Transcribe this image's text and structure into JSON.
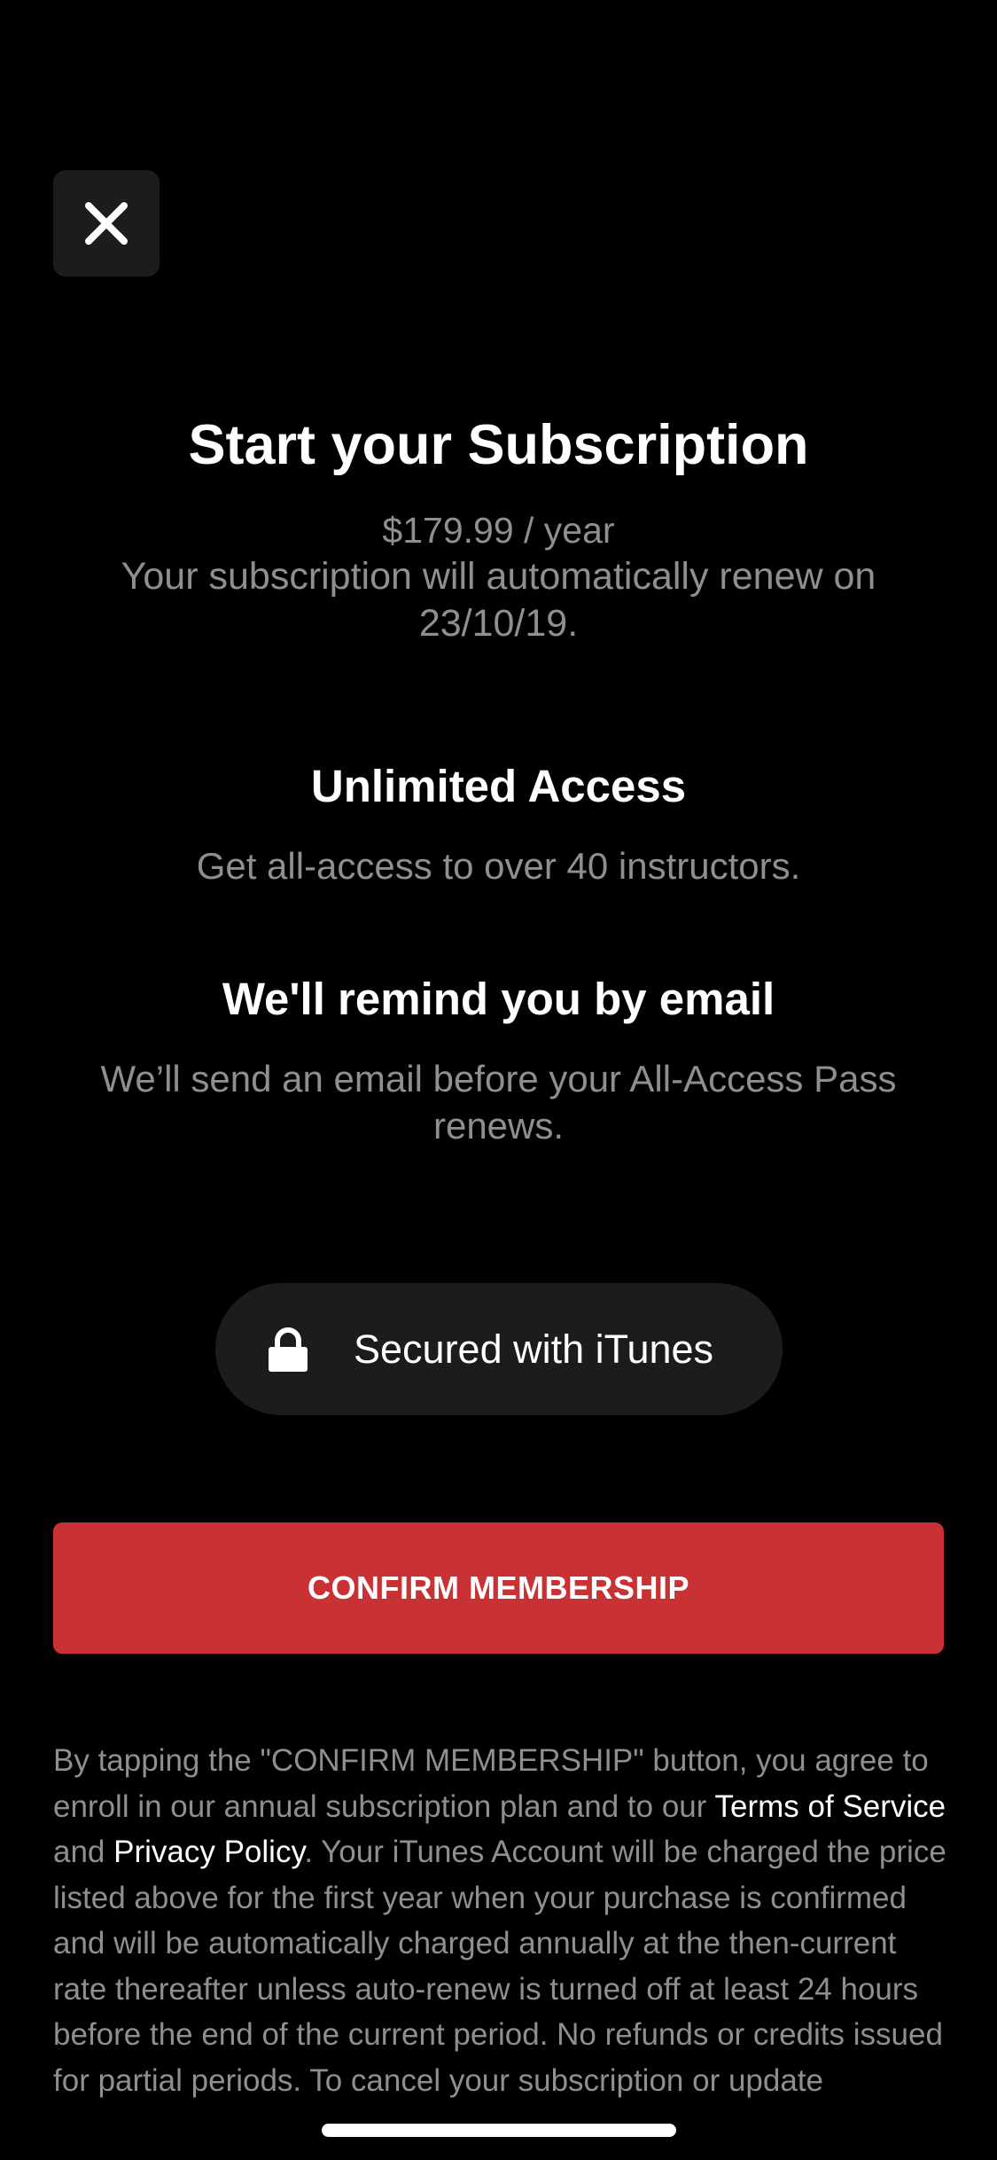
{
  "close": {
    "icon": "close-icon"
  },
  "header": {
    "title": "Start your Subscription",
    "price": "$179.99 / year",
    "renew_text": "Your subscription will automatically renew on 23/10/19."
  },
  "features": [
    {
      "title": "Unlimited Access",
      "description": "Get all-access to over 40 instructors."
    },
    {
      "title": "We'll remind you by email",
      "description": "We’ll send an email before your All-Access Pass renews."
    }
  ],
  "secured": {
    "icon": "lock-icon",
    "label": "Secured with iTunes"
  },
  "confirm": {
    "label": "CONFIRM MEMBERSHIP",
    "color": "#c93234"
  },
  "legal": {
    "part1": "By tapping the \"CONFIRM MEMBERSHIP\" button, you agree to enroll in our annual subscription plan and to our ",
    "terms_link": "Terms of Service",
    "and": " and ",
    "privacy_link": "Privacy Policy",
    "part2": ". Your iTunes Account will be charged the price listed above for the first year when your purchase is confirmed and will be automatically charged annually at the then-current rate thereafter unless auto-renew is turned off at least 24 hours before the end of the current period. No refunds or credits issued for partial periods. To cancel your subscription or update"
  }
}
